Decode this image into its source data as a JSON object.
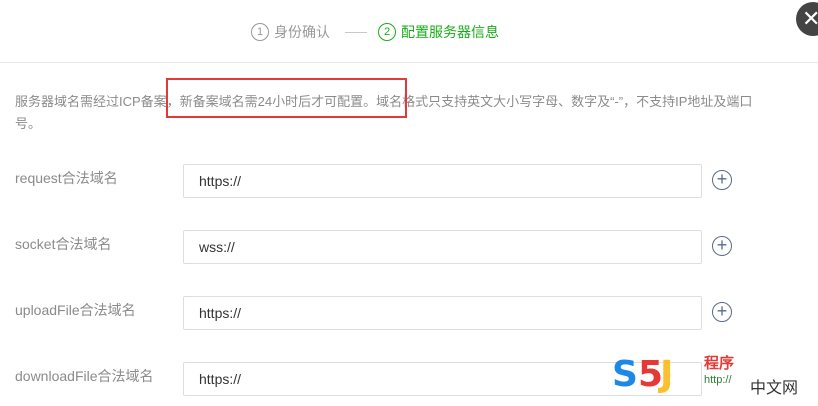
{
  "steps": [
    {
      "num": "1",
      "label": "身份确认"
    },
    {
      "num": "2",
      "label": "配置服务器信息"
    }
  ],
  "close_glyph": "✕",
  "notice": "服务器域名需经过ICP备案，新备案域名需24小时后才可配置。域名格式只支持英文大小写字母、数字及“-”，不支持IP地址及端口号。",
  "fields": [
    {
      "label": "request合法域名",
      "value": "https://"
    },
    {
      "label": "socket合法域名",
      "value": "wss://"
    },
    {
      "label": "uploadFile合法域名",
      "value": "https://"
    },
    {
      "label": "downloadFile合法域名",
      "value": "https://"
    }
  ],
  "add_glyph": "+",
  "watermark": {
    "s": "S",
    "five": "5",
    "j": "J",
    "cn": "程序",
    "php": "http://",
    "site": "中文网"
  },
  "colors": {
    "active": "#1aad19",
    "highlight": "#e03a3a",
    "add_icon": "#5a6b87"
  }
}
